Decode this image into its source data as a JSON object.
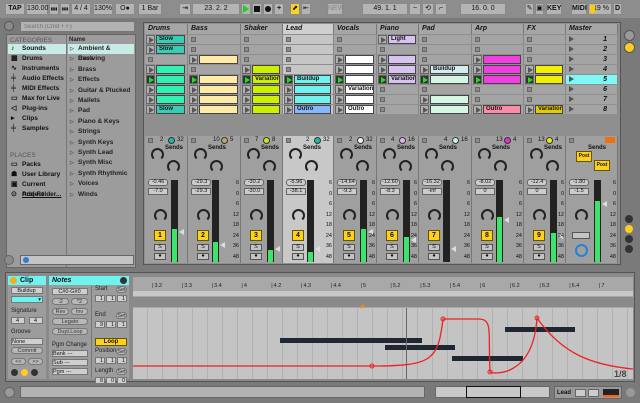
{
  "transport": {
    "tap": "TAP",
    "tempo": "130.00",
    "nudge_down": "▮▮▮",
    "nudge_up": "▮▮▮",
    "signature": "4 / 4",
    "zoom": "130%",
    "metronome": "O●",
    "quantize": "1 Bar",
    "follow": "⇥",
    "position": "23.  2.  2",
    "new": "NEW",
    "loop_start": "49.  1.  1",
    "punch_in": "~",
    "loop": "⟲",
    "punch_out": "⌐",
    "loop_length": "16.  0.  0",
    "key": "KEY",
    "midi": "MIDI",
    "cpu": "19 %",
    "disk": "D",
    "draw": "✎"
  },
  "browser": {
    "search_placeholder": "Search (Cmd + F)",
    "categories_label": "CATEGORIES",
    "name_header": "Name",
    "places_label": "PLACES",
    "categories": [
      {
        "label": "Sounds",
        "icon": "♪"
      },
      {
        "label": "Drums",
        "icon": "▦"
      },
      {
        "label": "Instruments",
        "icon": "∿"
      },
      {
        "label": "Audio Effects",
        "icon": "╪"
      },
      {
        "label": "MIDI Effects",
        "icon": "╪"
      },
      {
        "label": "Max for Live",
        "icon": "▭"
      },
      {
        "label": "Plug-ins",
        "icon": "◁"
      },
      {
        "label": "Clips",
        "icon": "▸"
      },
      {
        "label": "Samples",
        "icon": "╪"
      }
    ],
    "places": [
      {
        "label": "Packs",
        "icon": "▭"
      },
      {
        "label": "User Library",
        "icon": "☗"
      },
      {
        "label": "Current Project",
        "icon": "▣"
      },
      {
        "label": "Add Folder...",
        "icon": "⊙"
      }
    ],
    "names": [
      "Ambient & Evolving",
      "Bass",
      "Brass",
      "Effects",
      "Guitar & Plucked",
      "Mallets",
      "Pad",
      "Piano & Keys",
      "Strings",
      "Synth Keys",
      "Synth Lead",
      "Synth Misc",
      "Synth Rhythmic",
      "Voices",
      "Winds"
    ]
  },
  "tracks": [
    {
      "name": "Drums",
      "clips": [
        {
          "n": "Slow",
          "c": "#36cfb6"
        },
        {
          "n": "Slow",
          "c": "#36cfb6"
        },
        null,
        {
          "n": "",
          "c": "#2ff2b2"
        },
        {
          "n": "",
          "c": "#2ff2b2",
          "p": 1
        },
        {
          "n": "",
          "c": "#2ff2b2"
        },
        {
          "n": "",
          "c": "#2ff2b2"
        },
        {
          "n": "Slow",
          "c": "#36cfb6"
        }
      ],
      "io_a": "2",
      "io_b": "32",
      "dot": "#1fb8a8",
      "vol": "-0.46",
      "vol2": "-7.0",
      "num": "1",
      "level": 0.4
    },
    {
      "name": "Bass",
      "clips": [
        null,
        null,
        {
          "n": "",
          "c": "#ffeaa6"
        },
        null,
        {
          "n": "",
          "c": "#ffeaa6",
          "p": 1
        },
        {
          "n": "",
          "c": "#ffeaa6"
        },
        {
          "n": "",
          "c": "#ffeaa6"
        },
        {
          "n": "",
          "c": "#ffeaa6"
        }
      ],
      "io_a": "10",
      "io_b": "5",
      "dot": "#b8a860",
      "vol": "-29.3",
      "vol2": "-29.3",
      "num": "2",
      "level": 0.25
    },
    {
      "name": "Shaker",
      "clips": [
        null,
        null,
        null,
        {
          "n": "",
          "c": "#ccf000"
        },
        {
          "n": "Variation",
          "c": "#ccf000",
          "p": 1
        },
        {
          "n": "",
          "c": "#ccf000"
        },
        {
          "n": "",
          "c": "#ccf000"
        },
        {
          "n": "",
          "c": "#ccf000"
        }
      ],
      "io_a": "7",
      "io_b": "8",
      "dot": "#c8e818",
      "vol": "-30.2",
      "vol2": "-30.0",
      "num": "3",
      "level": 0.15
    },
    {
      "name": "Lead",
      "clips": [
        null,
        null,
        null,
        null,
        {
          "n": "Buildup",
          "c": "#6ef3f0",
          "p": 1
        },
        {
          "n": "",
          "c": "#6ef3f0"
        },
        {
          "n": "",
          "c": "#6ef3f0"
        },
        {
          "n": "Outro",
          "c": "#85b8ff"
        }
      ],
      "io_a": "2",
      "io_b": "32",
      "dot": "#1fb8a8",
      "vol": "-5.96",
      "vol2": "-38.1",
      "num": "4",
      "level": 0.12,
      "selected": true
    },
    {
      "name": "Vocals",
      "clips": [
        null,
        null,
        {
          "n": "",
          "c": "#ffffff"
        },
        {
          "n": "",
          "c": "#ffffff"
        },
        {
          "n": "",
          "c": "#ffffff",
          "p": 1
        },
        {
          "n": "Variation",
          "c": "#ffffff"
        },
        {
          "n": "",
          "c": "#ffffff"
        },
        {
          "n": "Outro",
          "c": "#ffffff"
        }
      ],
      "io_a": "2",
      "io_b": "32",
      "dot": "#f0f0f0",
      "vol": "-14.64",
      "vol2": "-9.3",
      "num": "5",
      "level": 0.4
    },
    {
      "name": "Piano",
      "clips": [
        {
          "n": "Light",
          "c": "#d8c2f0"
        },
        null,
        {
          "n": "",
          "c": "#d8c2f0"
        },
        {
          "n": "",
          "c": "#d8c2f0"
        },
        {
          "n": "Variation",
          "c": "#d8c2f0",
          "p": 1
        },
        null,
        null,
        null
      ],
      "io_a": "4",
      "io_b": "16",
      "dot": "#d8b8f0",
      "vol": "-12.60",
      "vol2": "-8.3",
      "num": "6",
      "level": 0.3
    },
    {
      "name": "Pad",
      "clips": [
        null,
        null,
        null,
        {
          "n": "Buildup",
          "c": "#d4eef0"
        },
        {
          "n": "",
          "c": "#d4f6e2",
          "p": 1
        },
        null,
        {
          "n": "",
          "c": "#d4f6e2"
        },
        {
          "n": "",
          "c": "#d4f6e2"
        }
      ],
      "io_a": "4",
      "io_b": "16",
      "dot": "#c8f0ec",
      "vol": "-16.32",
      "vol2": "-inf",
      "num": "7",
      "level": 0.0
    },
    {
      "name": "Arp",
      "clips": [
        null,
        null,
        {
          "n": "",
          "c": "#f03ee0"
        },
        {
          "n": "",
          "c": "#f03ee0"
        },
        {
          "n": "",
          "c": "#f03ee0",
          "p": 1
        },
        null,
        null,
        {
          "n": "Outro",
          "c": "#ff8aa8"
        }
      ],
      "io_a": "13",
      "io_b": "4",
      "dot": "#e030d0",
      "vol": "-8.02",
      "vol2": "0",
      "num": "8",
      "level": 0.55
    },
    {
      "name": "FX",
      "clips": [
        null,
        null,
        null,
        {
          "n": "",
          "c": "#f2f000"
        },
        {
          "n": "",
          "c": "#f2f000",
          "p": 1
        },
        null,
        null,
        {
          "n": "Variation",
          "c": "#e2cc00"
        }
      ],
      "io_a": "13",
      "io_b": "4",
      "dot": "#e8e818",
      "vol": "-12.4",
      "vol2": "0",
      "num": "9",
      "level": 0.35
    }
  ],
  "master": {
    "name": "Master",
    "scenes": [
      "1",
      "2",
      "3",
      "4",
      "5",
      "6",
      "7",
      "8"
    ],
    "vol": "-1.80",
    "vol2": "-1.5",
    "post": "Post",
    "level": 0.75
  },
  "mixer": {
    "sends": "Sends",
    "scale": [
      "6",
      "0",
      "6",
      "12",
      "18",
      "24",
      "36",
      "48"
    ],
    "solo": "S",
    "rec": "●"
  },
  "clip": {
    "title": "Clip",
    "name": "Buildup",
    "signature_label": "Signature",
    "sig_num": "4",
    "sig_den": "4",
    "groove_label": "Groove",
    "groove": "None",
    "commit": "Commit",
    "prev": "<<",
    "next": ">>"
  },
  "notes": {
    "title": "Notes",
    "range": "C#0-G#0",
    "half": ":2",
    "double": "*2",
    "rev": "Rev",
    "inv": "Inv",
    "legato": "Legato",
    "dupl": "Dupl.Loop",
    "pgm_label": "Pgm Change",
    "bank": "Bank ---",
    "sub": "Sub ---",
    "pgm": "Pgm ---",
    "start_label": "Start",
    "end_label": "End",
    "set": "Set",
    "start": [
      "1",
      "1",
      "1"
    ],
    "end": [
      "9",
      "1",
      "1"
    ],
    "loop": "Loop",
    "position_label": "Position",
    "position": [
      "1",
      "1",
      "1"
    ],
    "length_label": "Length",
    "length": [
      "8",
      "0",
      "0"
    ]
  },
  "roll": {
    "ruler": [
      "3.2",
      "3.3",
      "3.4",
      "4",
      "4.2",
      "4.3",
      "4.4",
      "5",
      "5.2",
      "5.3",
      "5.4",
      "6",
      "6.2",
      "6.3",
      "6.4",
      "7"
    ],
    "grid": "1/8"
  },
  "status": {
    "track": "Lead"
  }
}
